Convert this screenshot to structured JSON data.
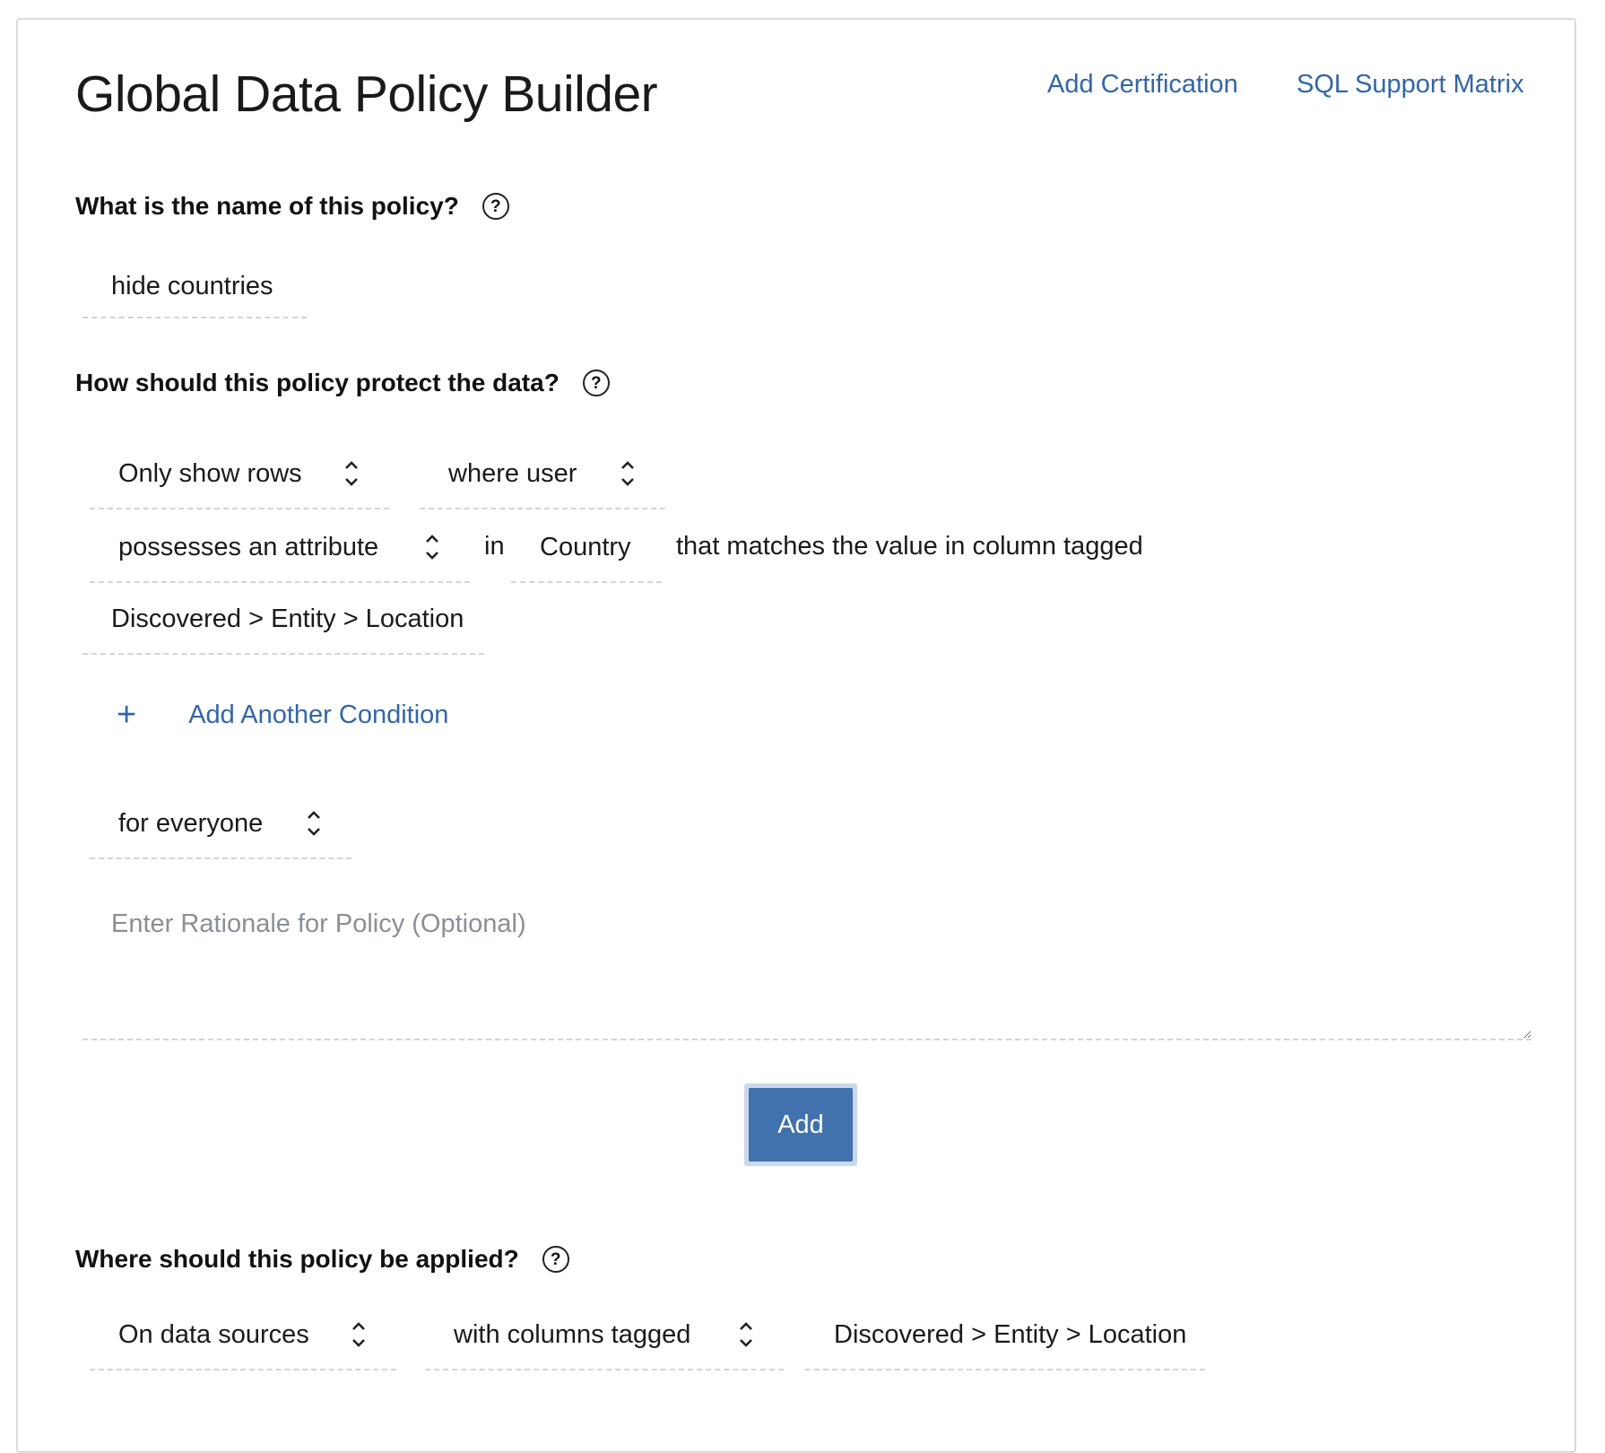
{
  "header": {
    "title": "Global Data Policy Builder",
    "links": [
      "Add Certification",
      "SQL Support Matrix"
    ]
  },
  "policy_name": {
    "question": "What is the name of this policy?",
    "help_glyph": "?",
    "value": "hide countries"
  },
  "protect": {
    "question": "How should this policy protect the data?",
    "help_glyph": "?",
    "action_select": "Only show rows",
    "condition_select": "where user",
    "attribute_select": "possesses an attribute",
    "in_text": "in",
    "attribute_value": "Country",
    "matches_text": "that matches the value in column tagged",
    "column_tag": "Discovered > Entity > Location",
    "add_condition_icon": "+",
    "add_condition_label": "Add Another Condition",
    "audience_select": "for everyone",
    "rationale_placeholder": "Enter Rationale for Policy (Optional)",
    "add_button": "Add"
  },
  "apply": {
    "question": "Where should this policy be applied?",
    "help_glyph": "?",
    "scope_select": "On data sources",
    "filter_select": "with columns tagged",
    "tag_value": "Discovered > Entity > Location"
  },
  "colors": {
    "link": "#3366a6",
    "button": "#4172ad",
    "button_halo": "#c9d8ea",
    "border": "#dadada"
  }
}
